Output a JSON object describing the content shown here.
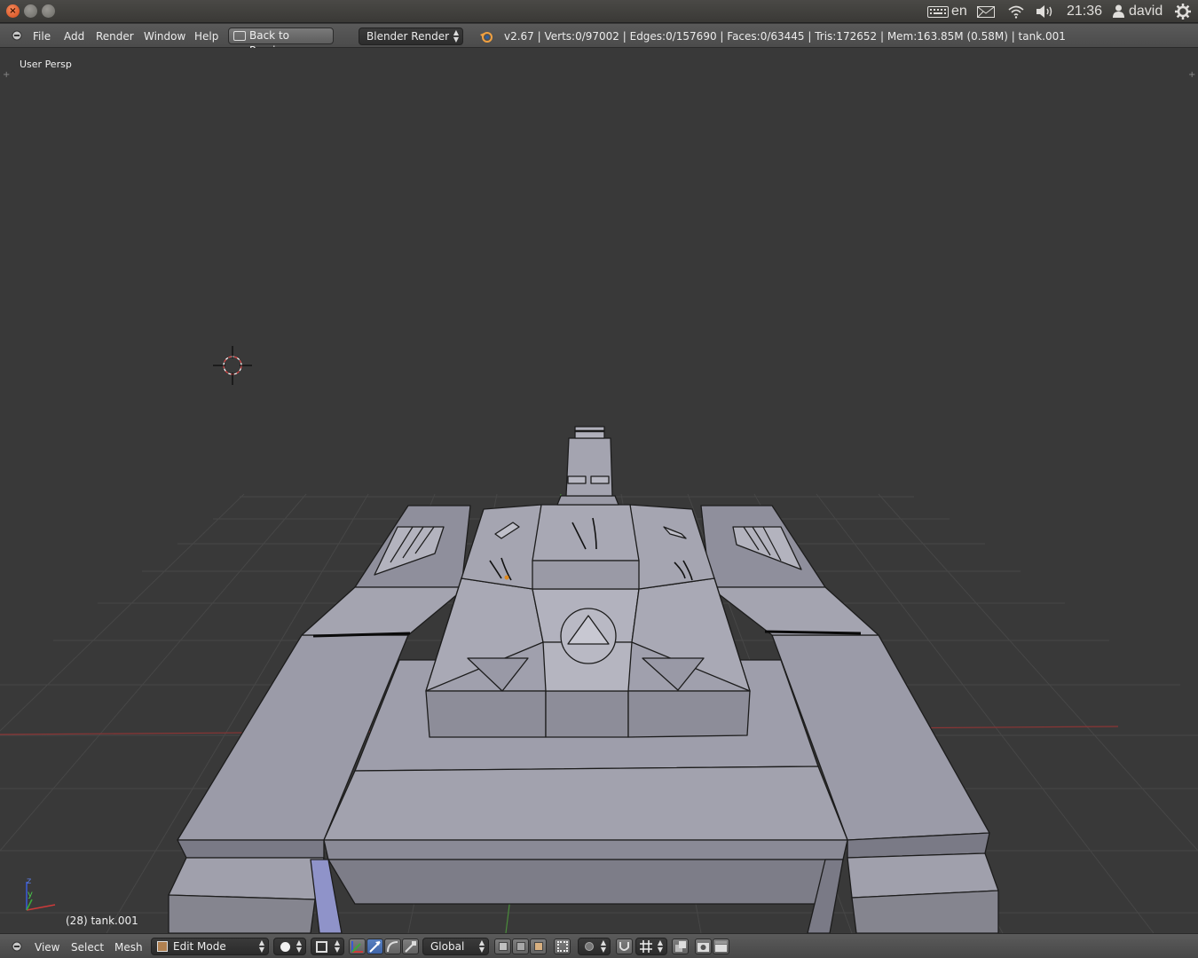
{
  "os_panel": {
    "keyboard_layout": "en",
    "time": "21:36",
    "user": "david",
    "icons": [
      "keyboard-icon",
      "mail-icon",
      "wifi-icon",
      "volume-icon",
      "user-icon",
      "gear-icon"
    ]
  },
  "info_header": {
    "menu": [
      "File",
      "Add",
      "Render",
      "Window",
      "Help"
    ],
    "back_button": "Back to Previous",
    "render_engine": "Blender Render",
    "stats": "v2.67 | Verts:0/97002 | Edges:0/157690 | Faces:0/63445 | Tris:172652 | Mem:163.85M (0.58M) | tank.001"
  },
  "viewport": {
    "view_label": "User Persp",
    "object_label": "(28) tank.001",
    "axis_labels": {
      "z": "z",
      "y": "y"
    }
  },
  "view_header": {
    "menu": [
      "View",
      "Select",
      "Mesh"
    ],
    "mode": "Edit Mode",
    "orientation": "Global"
  },
  "colors": {
    "viewport_bg": "#393939",
    "mesh_face": "#9a9aa6",
    "grid": "#474747",
    "x_axis": "#8c3535",
    "y_axis": "#4a8c3a"
  }
}
